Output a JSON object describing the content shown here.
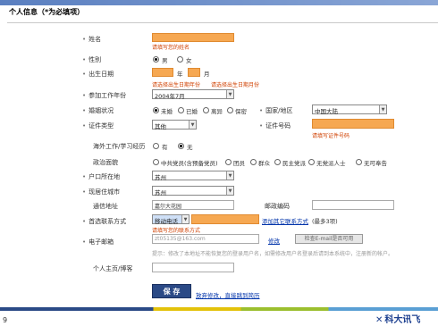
{
  "header": {
    "title": "个人信息（*为必填项）"
  },
  "fields": {
    "name": {
      "label": "姓名",
      "hint": "请填写您的姓名"
    },
    "gender": {
      "label": "性别",
      "options": [
        "男",
        "女"
      ],
      "selected": "男"
    },
    "birth": {
      "label": "出生日期",
      "year_unit": "年",
      "month_unit": "月",
      "hint_year": "请选择出生日期年份",
      "hint_month": "请选择出生日期月份"
    },
    "work_start": {
      "label": "参加工作年份",
      "value": "2004年7月"
    },
    "marital": {
      "label": "婚姻状况",
      "options": [
        "未婚",
        "已婚",
        "离异",
        "保密"
      ],
      "selected": "未婚"
    },
    "nationality": {
      "label": "国家/地区",
      "value": "中国大陆"
    },
    "id_type": {
      "label": "证件类型",
      "value": "其他"
    },
    "id_number": {
      "label": "证件号码",
      "hint": "请填写证件号码"
    },
    "overseas": {
      "label": "海外工作/学习经历",
      "options": [
        "有",
        "无"
      ],
      "selected": "无"
    },
    "political": {
      "label": "政治面貌",
      "options": [
        "中共党员(含预备党员)",
        "团员",
        "群众",
        "民主党派",
        "无党派人士",
        "无可奉告"
      ]
    },
    "hukou": {
      "label": "户口所在地",
      "value": "苏州"
    },
    "residence": {
      "label": "现居住城市",
      "value": "苏州"
    },
    "address": {
      "label": "通信地址",
      "value": "嘉尔大花园"
    },
    "postcode": {
      "label": "邮政编码"
    },
    "contact": {
      "label": "首选联系方式",
      "select_value": "移动电话",
      "add_link": "添加其它联系方式",
      "add_note": "(最多3项)",
      "hint": "请填写您的联系方式"
    },
    "email": {
      "label": "电子邮箱",
      "placeholder": "zt05135@163.com",
      "modify_link": "修改",
      "button": "检查E-mail是否可用",
      "note": "提示：修改了本地址不能恢复您的登录用户名，如需修改用户名登录后请到本系统中，注册新的帐户。"
    },
    "homepage": {
      "label": "个人主页/博客"
    }
  },
  "actions": {
    "save": "保 存",
    "cancel": "放弃修改，直接跳到简历"
  },
  "footer": {
    "page_number": "9",
    "brand": "科大讯飞"
  }
}
